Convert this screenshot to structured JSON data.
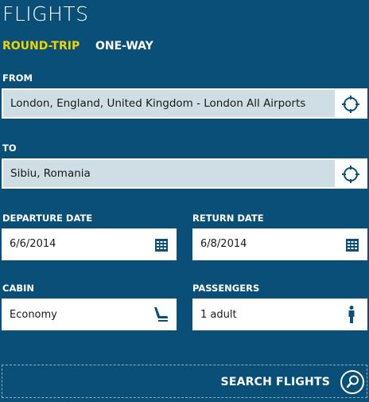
{
  "app": {
    "title": "FLIGHTS"
  },
  "tabs": {
    "round_trip": "ROUND-TRIP",
    "one_way": "ONE-WAY"
  },
  "from": {
    "label": "FROM",
    "value": "London, England, United Kingdom - London All Airports"
  },
  "to": {
    "label": "TO",
    "value": "Sibiu, Romania"
  },
  "departure": {
    "label": "DEPARTURE DATE",
    "value": "6/6/2014"
  },
  "return": {
    "label": "RETURN DATE",
    "value": "6/8/2014"
  },
  "cabin": {
    "label": "CABIN",
    "value": "Economy"
  },
  "passengers": {
    "label": "PASSENGERS",
    "value": "1 adult"
  },
  "search": {
    "label": "SEARCH FLIGHTS"
  },
  "colors": {
    "background": "#0a4f78",
    "accent": "#f0d400",
    "icon": "#0a4f78",
    "input_fill": "#cfdde5"
  },
  "icons": {
    "locate": "crosshair-icon",
    "calendar": "calendar-icon",
    "cabin": "seat-icon",
    "passenger": "person-icon",
    "search": "search-icon"
  }
}
